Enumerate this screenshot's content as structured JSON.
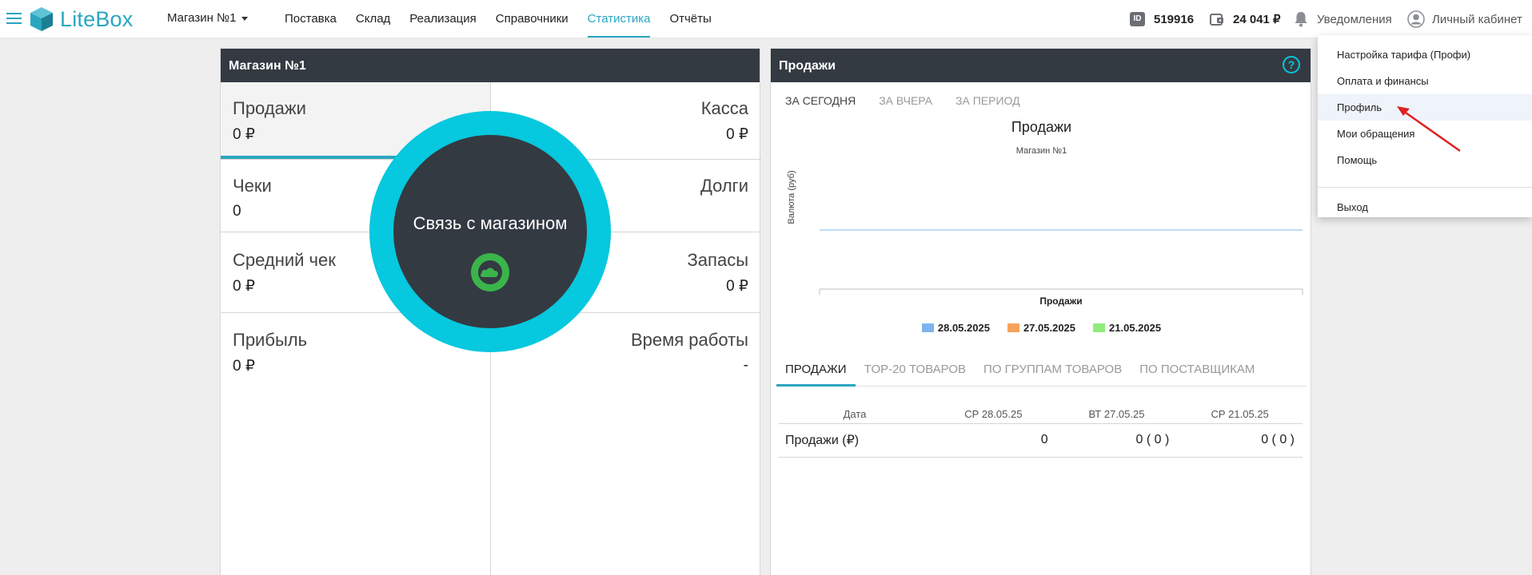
{
  "header": {
    "logo_text": "LiteBox",
    "store_selector": "Магазин №1",
    "nav": [
      {
        "label": "Поставка",
        "active": false
      },
      {
        "label": "Склад",
        "active": false
      },
      {
        "label": "Реализация",
        "active": false
      },
      {
        "label": "Справочники",
        "active": false
      },
      {
        "label": "Статистика",
        "active": true
      },
      {
        "label": "Отчёты",
        "active": false
      }
    ],
    "id_badge": "ID",
    "user_id": "519916",
    "balance": "24 041 ₽",
    "notifications_label": "Уведомления",
    "cabinet_label": "Личный кабинет"
  },
  "dropdown": {
    "items": [
      {
        "label": "Настройка тарифа (Профи)",
        "highlighted": false
      },
      {
        "label": "Оплата и финансы",
        "highlighted": false
      },
      {
        "label": "Профиль",
        "highlighted": true
      },
      {
        "label": "Мои обращения",
        "highlighted": false
      },
      {
        "label": "Помощь",
        "highlighted": false
      }
    ],
    "logout_label": "Выход"
  },
  "store_panel": {
    "title": "Магазин №1",
    "cells": {
      "sales": {
        "label": "Продажи",
        "value": "0 ₽"
      },
      "cash": {
        "label": "Касса",
        "value": "0 ₽"
      },
      "checks": {
        "label": "Чеки",
        "value": "0"
      },
      "debts": {
        "label": "Долги",
        "value": ""
      },
      "avg_check": {
        "label": "Средний чек",
        "value": "0 ₽"
      },
      "stock": {
        "label": "Запасы",
        "value": "0 ₽"
      },
      "profit": {
        "label": "Прибыль",
        "value": "0 ₽"
      },
      "work_time": {
        "label": "Время работы",
        "value": "-"
      }
    },
    "overlay_text": "Связь с магазином"
  },
  "sales_panel": {
    "title": "Продажи",
    "help_symbol": "?",
    "period_tabs": [
      {
        "label": "ЗА СЕГОДНЯ",
        "active": true
      },
      {
        "label": "ЗА ВЧЕРА",
        "active": false
      },
      {
        "label": "ЗА ПЕРИОД",
        "active": false
      }
    ],
    "sub_tabs": [
      {
        "label": "ПРОДАЖИ",
        "active": true
      },
      {
        "label": "TOP-20 ТОВАРОВ",
        "active": false
      },
      {
        "label": "ПО ГРУППАМ ТОВАРОВ",
        "active": false
      },
      {
        "label": "ПО ПОСТАВЩИКАМ",
        "active": false
      }
    ],
    "table": {
      "headers": [
        "Дата",
        "СР 28.05.25",
        "ВТ 27.05.25",
        "СР 21.05.25"
      ],
      "rows": [
        {
          "label": "Продажи (₽)",
          "values": [
            "0",
            "0 ( 0 )",
            "0 ( 0 )"
          ]
        }
      ]
    }
  },
  "chart_data": {
    "type": "bar",
    "title": "Продажи",
    "subtitle": "Магазин №1",
    "ylabel": "Валюта (руб)",
    "categories": [
      "Продажи"
    ],
    "series": [
      {
        "name": "28.05.2025",
        "values": [
          0
        ],
        "color": "#7cb5ec"
      },
      {
        "name": "27.05.2025",
        "values": [
          0
        ],
        "color": "#f7a35c"
      },
      {
        "name": "21.05.2025",
        "values": [
          0
        ],
        "color": "#90ed7d"
      }
    ],
    "ylim": [
      0,
      0
    ],
    "grid": false,
    "legend": "bottom"
  },
  "colors": {
    "accent": "#2aa6bf",
    "panel_header": "#343a42",
    "overlay_ring": "#06c8de",
    "cloud_badge": "#3ab54a"
  }
}
